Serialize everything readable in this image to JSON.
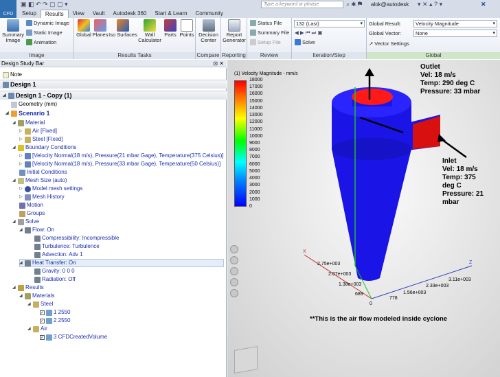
{
  "app": {
    "logo": "CFD",
    "tabs": [
      "Setup",
      "Results",
      "View",
      "Vault",
      "Autodesk 360",
      "Start & Learn",
      "Community"
    ],
    "active_tab": "Results",
    "search_placeholder": "Type a keyword or phrase",
    "user": "alok@autodesk"
  },
  "ribbon": {
    "image_group": {
      "label": "Image",
      "summary_image": "Summary Image",
      "dynamic_image": "Dynamic Image",
      "static_image": "Static Image",
      "animation": "Animation"
    },
    "results_tasks": {
      "label": "Results Tasks",
      "buttons": [
        "Global",
        "Planes",
        "Iso Surfaces",
        "Wall Calculator",
        "Parts",
        "Points"
      ]
    },
    "compare": {
      "label": "Compare",
      "button": "Decision Center"
    },
    "reporting": {
      "label": "Reporting",
      "button": "Report Generator"
    },
    "review": {
      "label": "Review",
      "status_file": "Status File",
      "summary_file": "Summary File",
      "setup_file": "Setup File"
    },
    "iteration": {
      "label": "Iteration/Step",
      "value": "132 (Last)",
      "solve": "Solve"
    },
    "global": {
      "label": "Global",
      "result_label": "Global Result:",
      "result_value": "Velocity Magnitude",
      "vector_label": "Global Vector:",
      "vector_value": "None",
      "vector_settings": "Vector Settings"
    }
  },
  "panel": {
    "title": "Design Study Bar",
    "note": "Note",
    "design1": "Design 1",
    "design_copy": "Design 1 - Copy (1)",
    "geometry": "Geometry (mm)",
    "scenario": "Scenario 1",
    "material": "Material",
    "air": "Air [Fixed]",
    "steel": "Steel [Fixed]",
    "bc": "Boundary Conditions",
    "bc1": "[Velocity Normal(18 m/s), Pressure(21 mbar Gage), Temperature(375 Celsius)]",
    "bc2": "[Velocity Normal(18 m/s), Pressure(33 mbar Gage), Temperature(50 Celsius)]",
    "initial": "Initial Conditions",
    "mesh_size": "Mesh Size (auto)",
    "mesh_settings": "Model mesh settings",
    "mesh_history": "Mesh History",
    "motion": "Motion",
    "groups": "Groups",
    "solve": "Solve",
    "flow": "Flow: On",
    "compress": "Compressibility: Incompressible",
    "turb": "Turbulence: Turbulence",
    "advection": "Advection: Adv 1",
    "heat": "Heat Transfer: On",
    "gravity": "Gravity: 0 0 0",
    "radiation": "Radiation: Off",
    "results": "Results",
    "materials": "Materials",
    "steel2": "Steel",
    "item1": "1 2550",
    "item2": "2 2550",
    "air2": "Air",
    "item3": "3 CFDCreatedVolume"
  },
  "viewport": {
    "legend_title": "(1) Velocity Magnitude - mm/s",
    "legend_ticks": [
      "18000",
      "17000",
      "16000",
      "15000",
      "14000",
      "13000",
      "12000",
      "11000",
      "10000",
      "9000",
      "8000",
      "7000",
      "6000",
      "5000",
      "4000",
      "3000",
      "2000",
      "1000",
      "0"
    ],
    "outlet": [
      "Outlet",
      "Vel: 18 m/s",
      "Temp: 290 deg C",
      "Pressure: 33 mbar"
    ],
    "inlet": [
      "Inlet",
      "Vel: 18 m/s",
      "Temp: 375",
      "deg C",
      "Pressure: 21",
      "mbar"
    ],
    "caption": "**This is the air flow modeled inside cyclone",
    "axis": {
      "x_labels": [
        "2.75e+003",
        "2.07e+003",
        "1.38e+003",
        "689"
      ],
      "z_labels": [
        "778",
        "1.56e+003",
        "2.33e+003",
        "3.11e+003"
      ],
      "origin": "0",
      "x_letter": "X",
      "y_letter": "Y",
      "z_letter": "Z"
    },
    "colors": {
      "body": "#1a14e6",
      "top_disc": "#ff1a1a",
      "inlet_face": "#d81010"
    }
  }
}
